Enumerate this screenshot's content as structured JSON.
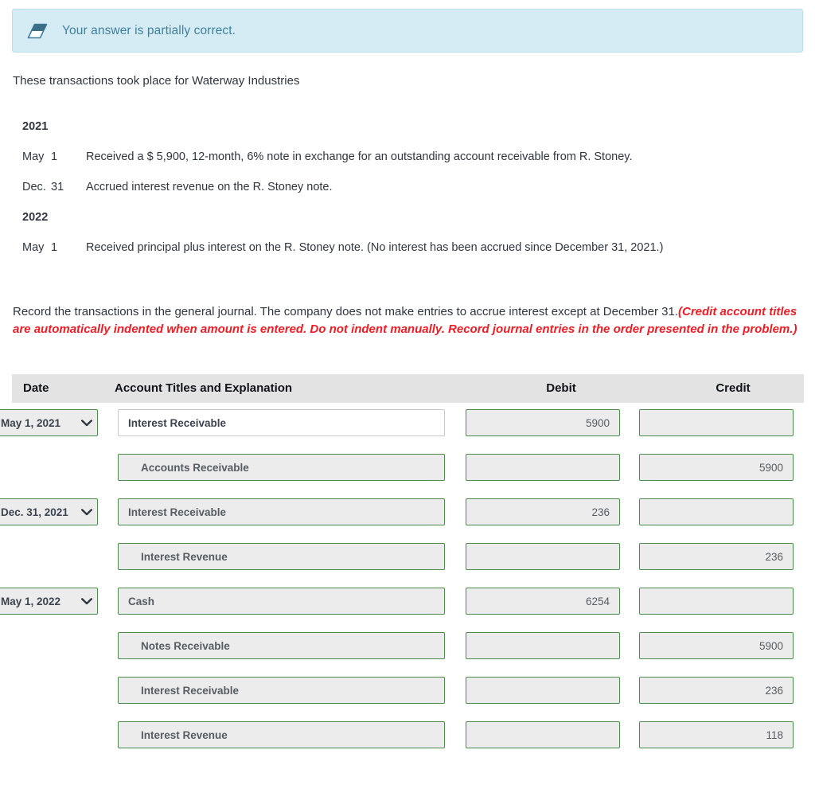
{
  "banner": {
    "icon": "eraser-icon",
    "message": "Your answer is partially correct.",
    "background_color": "#d6ecf5",
    "border_color": "#bcdfee",
    "text_color": "#3f7f9c"
  },
  "intro": "These transactions took place for Waterway Industries",
  "transactions": [
    {
      "type": "year",
      "label": "2021"
    },
    {
      "type": "entry",
      "month": "May",
      "day": "1",
      "description": "Received a $ 5,900, 12-month,  6% note in exchange for an outstanding account receivable from R. Stoney."
    },
    {
      "type": "entry",
      "month": "Dec.",
      "day": "31",
      "description": "Accrued interest revenue on the R. Stoney note."
    },
    {
      "type": "year",
      "label": "2022"
    },
    {
      "type": "entry",
      "month": "May",
      "day": "1",
      "description": "Received principal plus interest on the R. Stoney note. (No interest has been accrued since December 31, 2021.)"
    }
  ],
  "instructions": {
    "main": "Record the transactions in the general journal. The company does not make entries to accrue interest except at December 31.",
    "hint": "(Credit account titles are automatically indented when amount is entered. Do not indent manually. Record journal entries in the order presented in the problem.)",
    "hint_color": "#ee1c25"
  },
  "journal": {
    "headers": {
      "date": "Date",
      "titles": "Account Titles and Explanation",
      "debit": "Debit",
      "credit": "Credit"
    },
    "header_background": "#e3e3e3",
    "field_border_color": "#4c8c4a",
    "field_background": "#ececec",
    "rows": [
      {
        "date": "May 1, 2021",
        "has_date": true,
        "account": "Interest Receivable",
        "indented": false,
        "plain_style": true,
        "debit": "5900",
        "credit": ""
      },
      {
        "date": "",
        "has_date": false,
        "account": "Accounts Receivable",
        "indented": true,
        "plain_style": false,
        "debit": "",
        "credit": "5900"
      },
      {
        "date": "Dec. 31, 2021",
        "has_date": true,
        "account": "Interest Receivable",
        "indented": false,
        "plain_style": false,
        "debit": "236",
        "credit": ""
      },
      {
        "date": "",
        "has_date": false,
        "account": "Interest Revenue",
        "indented": true,
        "plain_style": false,
        "debit": "",
        "credit": "236"
      },
      {
        "date": "May 1, 2022",
        "has_date": true,
        "account": "Cash",
        "indented": false,
        "plain_style": false,
        "debit": "6254",
        "credit": ""
      },
      {
        "date": "",
        "has_date": false,
        "account": "Notes Receivable",
        "indented": true,
        "plain_style": false,
        "debit": "",
        "credit": "5900"
      },
      {
        "date": "",
        "has_date": false,
        "account": "Interest Receivable",
        "indented": true,
        "plain_style": false,
        "debit": "",
        "credit": "236"
      },
      {
        "date": "",
        "has_date": false,
        "account": "Interest Revenue",
        "indented": true,
        "plain_style": false,
        "debit": "",
        "credit": "118"
      }
    ]
  }
}
